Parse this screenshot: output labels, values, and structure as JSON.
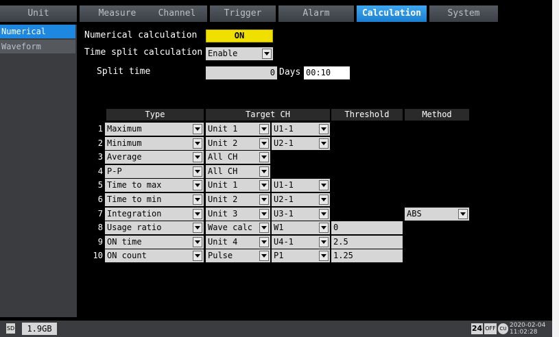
{
  "tabs": [
    {
      "label": "Unit",
      "active": false
    },
    {
      "label": "Measure",
      "active": false
    },
    {
      "label": "Channel",
      "active": false
    },
    {
      "label": "Trigger",
      "active": false
    },
    {
      "label": "Alarm",
      "active": false
    },
    {
      "label": "Calculation",
      "active": true
    },
    {
      "label": "System",
      "active": false
    }
  ],
  "sidebar": {
    "items": [
      {
        "label": "Numerical",
        "active": true
      },
      {
        "label": "Waveform",
        "active": false
      }
    ]
  },
  "settings": {
    "numerical_label": "Numerical calculation",
    "numerical_value": "ON",
    "time_split_label": "Time split calculation",
    "time_split_value": "Enable",
    "split_time_label": "Split time",
    "split_days_value": "0",
    "days_label": "Days",
    "split_time_value": "00:10"
  },
  "table": {
    "headers": {
      "type": "Type",
      "target": "Target CH",
      "threshold": "Threshold",
      "method": "Method"
    },
    "rows": [
      {
        "no": "1",
        "type": "Maximum",
        "target1": "Unit 1",
        "target2": "U1-1",
        "threshold": "",
        "method": ""
      },
      {
        "no": "2",
        "type": "Minimum",
        "target1": "Unit 2",
        "target2": "U2-1",
        "threshold": "",
        "method": ""
      },
      {
        "no": "3",
        "type": "Average",
        "target1": "All CH",
        "target2": "",
        "threshold": "",
        "method": ""
      },
      {
        "no": "4",
        "type": "P-P",
        "target1": "All CH",
        "target2": "",
        "threshold": "",
        "method": ""
      },
      {
        "no": "5",
        "type": "Time to max",
        "target1": "Unit 1",
        "target2": "U1-1",
        "threshold": "",
        "method": ""
      },
      {
        "no": "6",
        "type": "Time to min",
        "target1": "Unit 2",
        "target2": "U2-1",
        "threshold": "",
        "method": ""
      },
      {
        "no": "7",
        "type": "Integration",
        "target1": "Unit 3",
        "target2": "U3-1",
        "threshold": "",
        "method": "ABS"
      },
      {
        "no": "8",
        "type": "Usage ratio",
        "target1": "Wave calc",
        "target2": "W1",
        "threshold": "0",
        "method": ""
      },
      {
        "no": "9",
        "type": "ON time",
        "target1": "Unit 4",
        "target2": "U4-1",
        "threshold": "2.5",
        "method": ""
      },
      {
        "no": "10",
        "type": "ON count",
        "target1": "Pulse",
        "target2": "P1",
        "threshold": "1.25",
        "method": ""
      }
    ]
  },
  "status": {
    "sd_label": "SD",
    "storage": "1.9GB",
    "icon_24": "24",
    "icon_off": "OFF",
    "icon_clock": "CU",
    "date": "2020-02-04",
    "time": "11:02:28"
  },
  "colors": {
    "accent": "#1e88e0",
    "on_button": "#f0e000",
    "field": "#d6d6d6"
  },
  "icons": [
    "sd-card-icon",
    "dropdown-arrow-icon",
    "auto-save-icon",
    "off-icon",
    "clock-icon"
  ]
}
